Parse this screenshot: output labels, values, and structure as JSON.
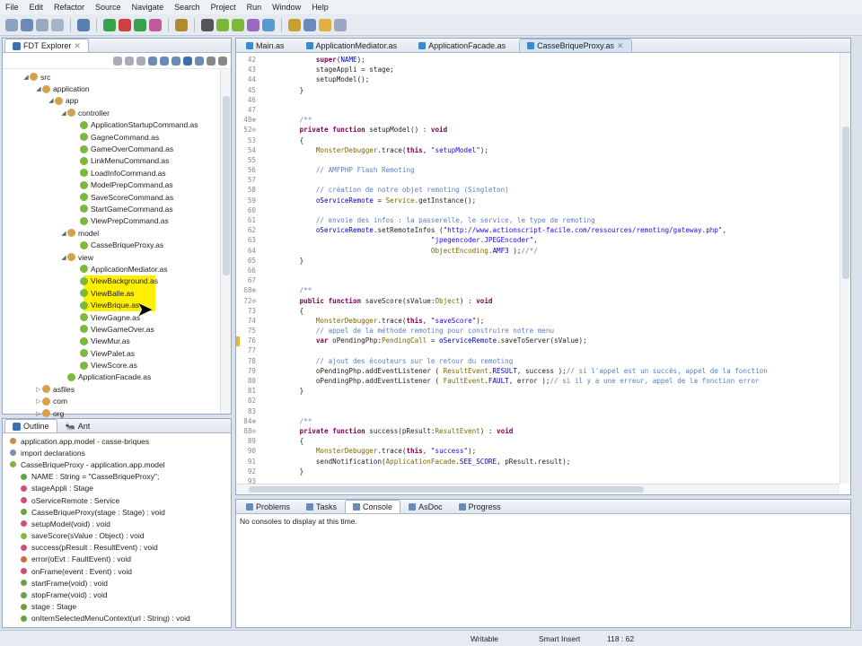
{
  "menu": [
    "File",
    "Edit",
    "Refactor",
    "Source",
    "Navigate",
    "Search",
    "Project",
    "Run",
    "Window",
    "Help"
  ],
  "colors": {
    "accent": "#3a6fb0",
    "keyword": "#7f0055",
    "comment": "#5b7fbf",
    "string": "#2a00ff",
    "folder": "#d4a24a",
    "class": "#7cb83a"
  },
  "explorer": {
    "tab": "FDT Explorer",
    "tree": [
      {
        "d": 0,
        "label": "src",
        "t": "pkg",
        "open": true
      },
      {
        "d": 1,
        "label": "application",
        "t": "pkg",
        "open": true
      },
      {
        "d": 2,
        "label": "app",
        "t": "pkg",
        "open": true
      },
      {
        "d": 3,
        "label": "controller",
        "t": "pkg",
        "open": true
      },
      {
        "d": 4,
        "label": "ApplicationStartupCommand.as",
        "t": "cls"
      },
      {
        "d": 4,
        "label": "GagneCommand.as",
        "t": "cls"
      },
      {
        "d": 4,
        "label": "GameOverCommand.as",
        "t": "cls"
      },
      {
        "d": 4,
        "label": "LinkMenuCommand.as",
        "t": "cls"
      },
      {
        "d": 4,
        "label": "LoadInfoCommand.as",
        "t": "cls"
      },
      {
        "d": 4,
        "label": "ModelPrepCommand.as",
        "t": "cls"
      },
      {
        "d": 4,
        "label": "SaveScoreCommand.as",
        "t": "cls"
      },
      {
        "d": 4,
        "label": "StartGameCommand.as",
        "t": "cls"
      },
      {
        "d": 4,
        "label": "ViewPrepCommand.as",
        "t": "cls"
      },
      {
        "d": 3,
        "label": "model",
        "t": "pkg",
        "open": true
      },
      {
        "d": 4,
        "label": "CasseBriqueProxy.as",
        "t": "cls"
      },
      {
        "d": 3,
        "label": "view",
        "t": "pkg",
        "open": true
      },
      {
        "d": 4,
        "label": "ApplicationMediator.as",
        "t": "cls"
      },
      {
        "d": 4,
        "label": "ViewBackground.as",
        "t": "cls"
      },
      {
        "d": 4,
        "label": "ViewBalle.as",
        "t": "cls"
      },
      {
        "d": 4,
        "label": "ViewBrique.as",
        "t": "cls"
      },
      {
        "d": 4,
        "label": "ViewGagne.as",
        "t": "cls"
      },
      {
        "d": 4,
        "label": "ViewGameOver.as",
        "t": "cls"
      },
      {
        "d": 4,
        "label": "ViewMur.as",
        "t": "cls"
      },
      {
        "d": 4,
        "label": "ViewPalet.as",
        "t": "cls"
      },
      {
        "d": 4,
        "label": "ViewScore.as",
        "t": "cls"
      },
      {
        "d": 3,
        "label": "ApplicationFacade.as",
        "t": "cls"
      },
      {
        "d": 1,
        "label": "asfiles",
        "t": "pkg"
      },
      {
        "d": 1,
        "label": "com",
        "t": "pkg"
      },
      {
        "d": 1,
        "label": "org",
        "t": "pkg"
      }
    ]
  },
  "outline": {
    "tabs": [
      "Outline",
      "Ant"
    ],
    "items": [
      {
        "d": 0,
        "label": "application.app.model - casse-briques",
        "c": "#c98a4a"
      },
      {
        "d": 0,
        "label": "import declarations",
        "c": "#7a8fb0"
      },
      {
        "d": 0,
        "label": "CasseBriqueProxy - application.app.model",
        "c": "#7cb83a"
      },
      {
        "d": 1,
        "label": "NAME : String = \"CasseBriqueProxy\";",
        "c": "#6aa040"
      },
      {
        "d": 1,
        "label": "stageAppli : Stage",
        "c": "#d0507a"
      },
      {
        "d": 1,
        "label": "oServiceRemote : Service",
        "c": "#d0507a"
      },
      {
        "d": 1,
        "label": "CasseBriqueProxy(stage : Stage) : void",
        "c": "#6aa040"
      },
      {
        "d": 1,
        "label": "setupModel(void) : void",
        "c": "#d0507a"
      },
      {
        "d": 1,
        "label": "saveScore(sValue : Object) : void",
        "c": "#8ab832"
      },
      {
        "d": 1,
        "label": "success(pResult : ResultEvent) : void",
        "c": "#d0507a"
      },
      {
        "d": 1,
        "label": "error(oEvt : FaultEvent) : void",
        "c": "#d06a3a"
      },
      {
        "d": 1,
        "label": "onFrame(event : Event) : void",
        "c": "#d0507a"
      },
      {
        "d": 1,
        "label": "startFrame(void) : void",
        "c": "#6aa040"
      },
      {
        "d": 1,
        "label": "stopFrame(void) : void",
        "c": "#6aa040"
      },
      {
        "d": 1,
        "label": "stage : Stage",
        "c": "#6aa040"
      },
      {
        "d": 1,
        "label": "onItemSelectedMenuContext(url : String) : void",
        "c": "#6aa040"
      }
    ]
  },
  "editor": {
    "tabs": [
      "Main.as",
      "ApplicationMediator.as",
      "ApplicationFacade.as",
      "CasseBriqueProxy.as"
    ],
    "active": 3,
    "lines": [
      {
        "n": "42",
        "s": [
          [
            "",
            "            "
          ],
          [
            "kw",
            "super"
          ],
          [
            "",
            "("
          ],
          [
            "id",
            "NAME"
          ],
          [
            "",
            "); "
          ]
        ]
      },
      {
        "n": "43",
        "s": [
          [
            "",
            "            stageAppli = stage;"
          ]
        ]
      },
      {
        "n": "44",
        "s": [
          [
            "",
            "            setupModel();"
          ]
        ]
      },
      {
        "n": "45",
        "s": [
          [
            "",
            "        }"
          ]
        ]
      },
      {
        "n": "46",
        "s": []
      },
      {
        "n": "47",
        "s": []
      },
      {
        "n": "48⊕",
        "s": [
          [
            "cm",
            "        /**"
          ]
        ]
      },
      {
        "n": "52⊖",
        "s": [
          [
            "kw",
            "        private function "
          ],
          [
            "",
            "setupModel() : "
          ],
          [
            "kw",
            "void"
          ]
        ]
      },
      {
        "n": "53",
        "s": [
          [
            "",
            "        {"
          ]
        ]
      },
      {
        "n": "54",
        "s": [
          [
            "ty",
            "            MonsterDebugger"
          ],
          [
            "",
            ".trace("
          ],
          [
            "kw",
            "this"
          ],
          [
            "",
            ", "
          ],
          [
            "st",
            "\"setupModel\""
          ],
          [
            "",
            ");"
          ]
        ]
      },
      {
        "n": "55",
        "s": []
      },
      {
        "n": "56",
        "s": [
          [
            "cm",
            "            // AMFPHP Flash Remoting"
          ]
        ]
      },
      {
        "n": "57",
        "s": []
      },
      {
        "n": "58",
        "s": [
          [
            "cm",
            "            // création de notre objet remoting (Singleton)"
          ]
        ]
      },
      {
        "n": "59",
        "s": [
          [
            "id",
            "            oServiceRemote"
          ],
          [
            "",
            " = "
          ],
          [
            "ty",
            "Service"
          ],
          [
            "",
            ".getInstance();"
          ]
        ]
      },
      {
        "n": "60",
        "s": []
      },
      {
        "n": "61",
        "s": [
          [
            "cm",
            "            // envoie des infos : la passerelle, le service, le type de remoting"
          ]
        ]
      },
      {
        "n": "62",
        "s": [
          [
            "id",
            "            oServiceRemote"
          ],
          [
            "",
            ".setRemoteInfos ("
          ],
          [
            "st",
            "\"http://www.actionscript-facile.com/ressources/remoting/gateway.php\""
          ],
          [
            "",
            ","
          ]
        ]
      },
      {
        "n": "63",
        "s": [
          [
            "",
            "                                        "
          ],
          [
            "st",
            "\"jpegencoder.JPEGEncoder\""
          ],
          [
            "",
            ","
          ]
        ]
      },
      {
        "n": "64",
        "s": [
          [
            "",
            "                                        "
          ],
          [
            "ty",
            "ObjectEncoding"
          ],
          [
            "",
            "."
          ],
          [
            "id",
            "AMF3"
          ],
          [
            "",
            " );"
          ],
          [
            "cm",
            "//*/"
          ]
        ]
      },
      {
        "n": "65",
        "s": [
          [
            "",
            "        }"
          ]
        ]
      },
      {
        "n": "66",
        "s": []
      },
      {
        "n": "67",
        "s": []
      },
      {
        "n": "68⊕",
        "s": [
          [
            "cm",
            "        /**"
          ]
        ]
      },
      {
        "n": "72⊖",
        "s": [
          [
            "kw",
            "        public function "
          ],
          [
            "",
            "saveScore(sValue:"
          ],
          [
            "ty",
            "Object"
          ],
          [
            "",
            ") : "
          ],
          [
            "kw",
            "void"
          ]
        ]
      },
      {
        "n": "73",
        "s": [
          [
            "",
            "        {"
          ]
        ]
      },
      {
        "n": "74",
        "s": [
          [
            "ty",
            "            MonsterDebugger"
          ],
          [
            "",
            ".trace("
          ],
          [
            "kw",
            "this"
          ],
          [
            "",
            ", "
          ],
          [
            "st",
            "\"saveScore\""
          ],
          [
            "",
            ");"
          ]
        ]
      },
      {
        "n": "75",
        "s": [
          [
            "cm",
            "            // appel de la méthode remoting pour construire notre menu"
          ]
        ]
      },
      {
        "n": "76",
        "s": [
          [
            "kw",
            "            var "
          ],
          [
            "",
            "oPendingPhp:"
          ],
          [
            "ty",
            "PendingCall"
          ],
          [
            "",
            " = "
          ],
          [
            "id",
            "oServiceRemote"
          ],
          [
            "",
            ".saveToServer(sValue);"
          ]
        ],
        "warn": true
      },
      {
        "n": "77",
        "s": []
      },
      {
        "n": "78",
        "s": [
          [
            "cm",
            "            // ajout des écouteurs sur le retour du remoting"
          ]
        ]
      },
      {
        "n": "79",
        "s": [
          [
            "",
            "            oPendingPhp.addEventListener ( "
          ],
          [
            "ty",
            "ResultEvent"
          ],
          [
            "",
            "."
          ],
          [
            "id",
            "RESULT"
          ],
          [
            "",
            ", success );"
          ],
          [
            "cm",
            "// si l'appel est un succès, appel de la fonction"
          ]
        ]
      },
      {
        "n": "80",
        "s": [
          [
            "",
            "            oPendingPhp.addEventListener ( "
          ],
          [
            "ty",
            "FaultEvent"
          ],
          [
            "",
            "."
          ],
          [
            "id",
            "FAULT"
          ],
          [
            "",
            ", error );"
          ],
          [
            "cm",
            "// si il y a une erreur, appel de la fonction error"
          ]
        ]
      },
      {
        "n": "81",
        "s": [
          [
            "",
            "        }"
          ]
        ]
      },
      {
        "n": "82",
        "s": []
      },
      {
        "n": "83",
        "s": []
      },
      {
        "n": "84⊕",
        "s": [
          [
            "cm",
            "        /**"
          ]
        ]
      },
      {
        "n": "88⊖",
        "s": [
          [
            "kw",
            "        private function "
          ],
          [
            "",
            "success(pResult:"
          ],
          [
            "ty",
            "ResultEvent"
          ],
          [
            "",
            ") : "
          ],
          [
            "kw",
            "void"
          ]
        ]
      },
      {
        "n": "89",
        "s": [
          [
            "",
            "        {"
          ]
        ]
      },
      {
        "n": "90",
        "s": [
          [
            "ty",
            "            MonsterDebugger"
          ],
          [
            "",
            ".trace("
          ],
          [
            "kw",
            "this"
          ],
          [
            "",
            ", "
          ],
          [
            "st",
            "\"success\""
          ],
          [
            "",
            ");"
          ]
        ]
      },
      {
        "n": "91",
        "s": [
          [
            "",
            "            sendNotification("
          ],
          [
            "ty",
            "ApplicationFacade"
          ],
          [
            "",
            "."
          ],
          [
            "id",
            "SEE_SCORE"
          ],
          [
            "",
            ", pResult.result);"
          ]
        ]
      },
      {
        "n": "92",
        "s": [
          [
            "",
            "        }"
          ]
        ]
      },
      {
        "n": "93",
        "s": []
      }
    ]
  },
  "bottom": {
    "tabs": [
      "Problems",
      "Tasks",
      "Console",
      "AsDoc",
      "Progress"
    ],
    "active": 2,
    "message": "No consoles to display at this time."
  },
  "status": {
    "writable": "Writable",
    "insert": "Smart Insert",
    "position": "118 : 62"
  }
}
